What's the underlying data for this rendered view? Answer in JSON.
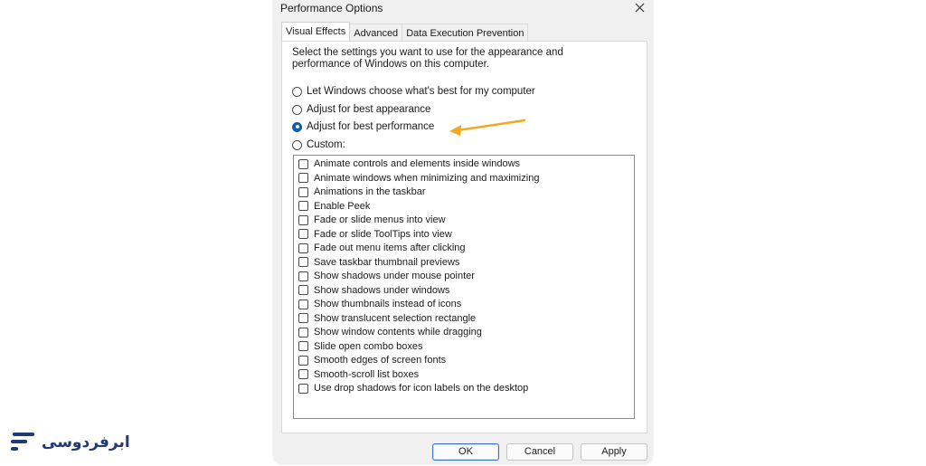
{
  "window": {
    "title": "Performance Options",
    "close_icon": "close-icon"
  },
  "tabs": [
    {
      "label": "Visual Effects",
      "active": true
    },
    {
      "label": "Advanced",
      "active": false
    },
    {
      "label": "Data Execution Prevention",
      "active": false
    }
  ],
  "visual_effects": {
    "description": "Select the settings you want to use for the appearance and performance of Windows on this computer.",
    "radios": [
      {
        "label": "Let Windows choose what's best for my computer",
        "checked": false
      },
      {
        "label": "Adjust for best appearance",
        "checked": false
      },
      {
        "label": "Adjust for best performance",
        "checked": true
      },
      {
        "label": "Custom:",
        "checked": false
      }
    ],
    "checkboxes": [
      {
        "label": "Animate controls and elements inside windows",
        "checked": false
      },
      {
        "label": "Animate windows when minimizing and maximizing",
        "checked": false
      },
      {
        "label": "Animations in the taskbar",
        "checked": false
      },
      {
        "label": "Enable Peek",
        "checked": false
      },
      {
        "label": "Fade or slide menus into view",
        "checked": false
      },
      {
        "label": "Fade or slide ToolTips into view",
        "checked": false
      },
      {
        "label": "Fade out menu items after clicking",
        "checked": false
      },
      {
        "label": "Save taskbar thumbnail previews",
        "checked": false
      },
      {
        "label": "Show shadows under mouse pointer",
        "checked": false
      },
      {
        "label": "Show shadows under windows",
        "checked": false
      },
      {
        "label": "Show thumbnails instead of icons",
        "checked": false
      },
      {
        "label": "Show translucent selection rectangle",
        "checked": false
      },
      {
        "label": "Show window contents while dragging",
        "checked": false
      },
      {
        "label": "Slide open combo boxes",
        "checked": false
      },
      {
        "label": "Smooth edges of screen fonts",
        "checked": false
      },
      {
        "label": "Smooth-scroll list boxes",
        "checked": false
      },
      {
        "label": "Use drop shadows for icon labels on the desktop",
        "checked": false
      }
    ]
  },
  "buttons": {
    "ok": "OK",
    "cancel": "Cancel",
    "apply": "Apply"
  },
  "annotation": {
    "arrow_color": "#f5a623"
  },
  "logo": {
    "text": "ابرفردوسی",
    "color": "#1f3a74",
    "icon": "brand-lines-icon"
  },
  "colors": {
    "selected_radio": "#0a5fb4",
    "default_button_border": "#3a6fc1"
  }
}
